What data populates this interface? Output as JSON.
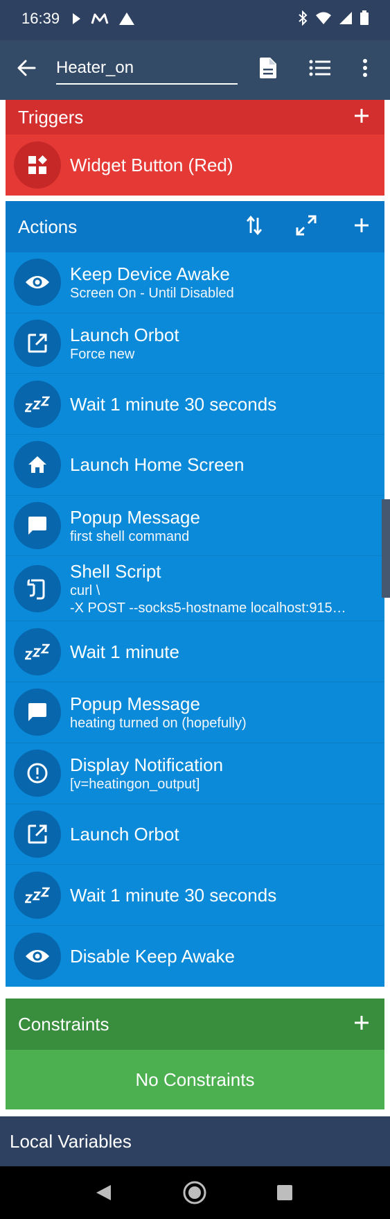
{
  "status_bar": {
    "time": "16:39"
  },
  "app_bar": {
    "title_value": "Heater_on"
  },
  "triggers": {
    "title": "Triggers",
    "items": [
      {
        "title": "Widget Button (Red)",
        "subtitle": "",
        "icon": "widget-icon"
      }
    ]
  },
  "actions": {
    "title": "Actions",
    "items": [
      {
        "title": "Keep Device Awake",
        "subtitle": "Screen On - Until Disabled",
        "icon": "eye-icon"
      },
      {
        "title": "Launch Orbot",
        "subtitle": "Force new",
        "icon": "launch-icon"
      },
      {
        "title": "Wait 1 minute 30 seconds",
        "subtitle": "",
        "icon": "sleep-icon"
      },
      {
        "title": "Launch Home Screen",
        "subtitle": "",
        "icon": "home-icon"
      },
      {
        "title": "Popup Message",
        "subtitle": "first shell command",
        "icon": "message-icon"
      },
      {
        "title": "Shell Script",
        "subtitle": "curl  \\",
        "subtitle2": "-X POST --socks5-hostname localhost:915…",
        "icon": "shell-icon"
      },
      {
        "title": "Wait 1 minute",
        "subtitle": "",
        "icon": "sleep-icon"
      },
      {
        "title": "Popup Message",
        "subtitle": "heating turned on (hopefully)",
        "icon": "message-icon"
      },
      {
        "title": "Display Notification",
        "subtitle": "[v=heatingon_output]",
        "icon": "alert-icon"
      },
      {
        "title": "Launch Orbot",
        "subtitle": "",
        "icon": "launch-icon"
      },
      {
        "title": "Wait 1 minute 30 seconds",
        "subtitle": "",
        "icon": "sleep-icon"
      },
      {
        "title": "Disable Keep Awake",
        "subtitle": "",
        "icon": "eye-icon"
      }
    ]
  },
  "constraints": {
    "title": "Constraints",
    "empty_label": "No Constraints"
  },
  "local_variables": {
    "title": "Local Variables"
  },
  "colors": {
    "triggers": "#e53935",
    "actions": "#0a8ad8",
    "constraints": "#4caf50",
    "app_bar": "#344b68"
  }
}
